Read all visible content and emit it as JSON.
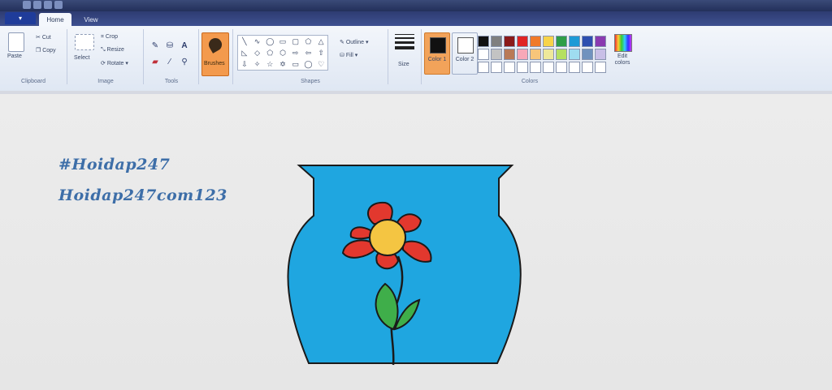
{
  "tabs": {
    "file": "",
    "home": "Home",
    "view": "View"
  },
  "clipboard": {
    "paste": "Paste",
    "cut": "Cut",
    "copy": "Copy",
    "group": "Clipboard"
  },
  "image": {
    "select": "Select",
    "crop": "Crop",
    "resize": "Resize",
    "rotate": "Rotate",
    "group": "Image"
  },
  "tools": {
    "text_tool": "A",
    "group": "Tools"
  },
  "brushes": {
    "label": "Brushes"
  },
  "shapes": {
    "outline": "Outline",
    "fill": "Fill",
    "group": "Shapes"
  },
  "size": {
    "label": "Size"
  },
  "colors": {
    "color1_label": "Color 1",
    "color2_label": "Color 2",
    "edit_label": "Edit colors",
    "group": "Colors",
    "color1": "#111111",
    "color2": "#ffffff",
    "palette": [
      "#111111",
      "#7f7f7f",
      "#8b1a1a",
      "#e02424",
      "#f07a2a",
      "#f7d34a",
      "#2e9e48",
      "#1e9ad6",
      "#2e4fb0",
      "#8a3ab0",
      "#ffffff",
      "#c3c3c3",
      "#b97a57",
      "#f7a8b8",
      "#f7c57a",
      "#eee89a",
      "#b5e061",
      "#9fdcf0",
      "#7092be",
      "#c8bfe7",
      "#ffffff",
      "#ffffff",
      "#ffffff",
      "#ffffff",
      "#ffffff",
      "#ffffff",
      "#ffffff",
      "#ffffff",
      "#ffffff",
      "#ffffff"
    ]
  },
  "canvas": {
    "watermark1": "#Hoidap247",
    "watermark2": "Hoidap247com123",
    "vase_color": "#1fa6e0",
    "petal_color": "#e2382e",
    "center_color": "#f4c542",
    "leaf_color": "#3fae4a"
  }
}
